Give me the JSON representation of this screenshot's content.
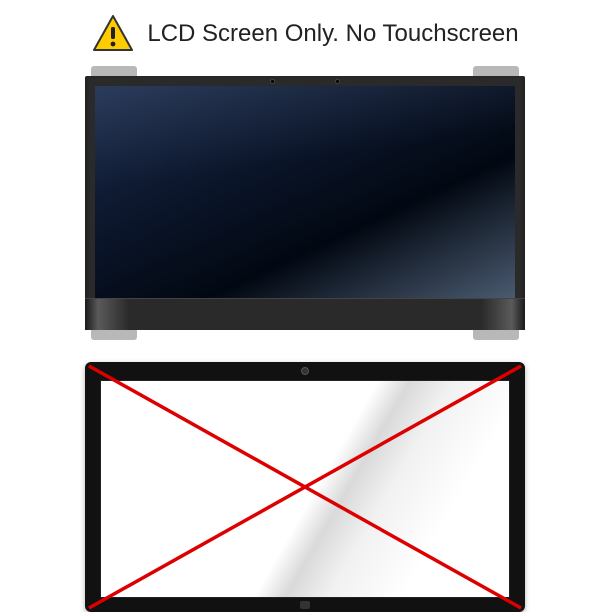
{
  "caption": "LCD Screen Only. No Touchscreen",
  "warning_color": "#ffcc00",
  "cross_color": "#d00000"
}
